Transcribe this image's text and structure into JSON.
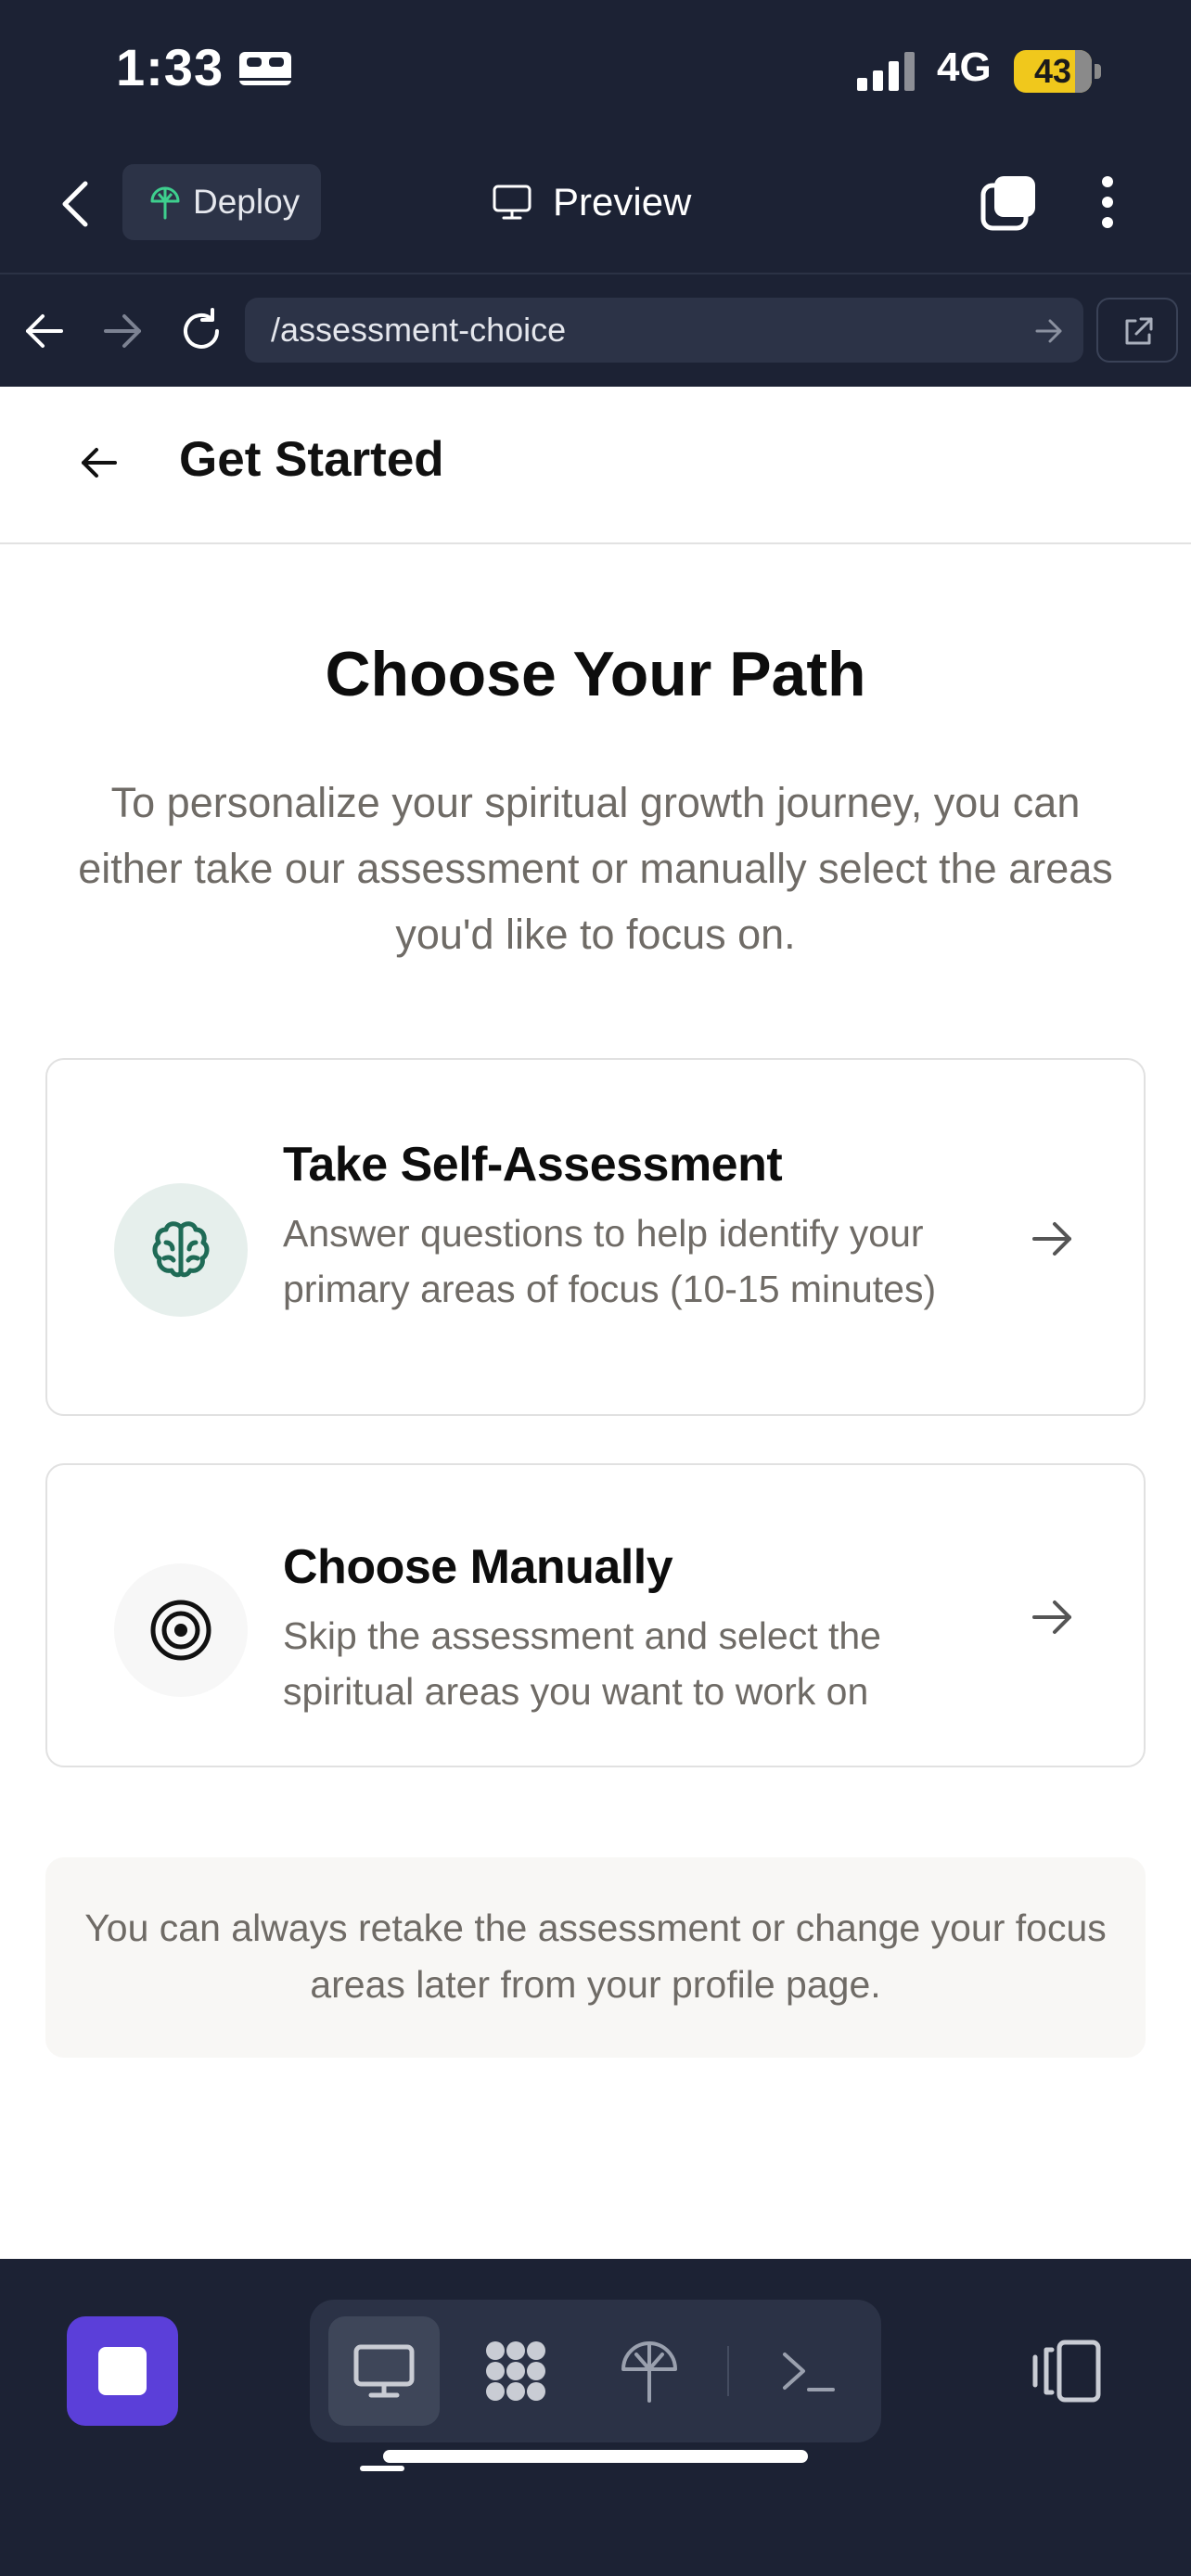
{
  "status_bar": {
    "time": "1:33",
    "network": "4G",
    "battery": "43",
    "icons": [
      "bed-icon",
      "signal-icon",
      "battery-icon"
    ]
  },
  "app_bar": {
    "deploy_label": "Deploy",
    "preview_label": "Preview",
    "icons": [
      "back-chevron-icon",
      "deploy-icon",
      "monitor-icon",
      "tabs-icon",
      "more-vertical-icon"
    ]
  },
  "browser": {
    "url": "/assessment-choice",
    "icons": [
      "arrow-left-icon",
      "arrow-right-icon",
      "reload-icon",
      "go-arrow-icon",
      "open-external-icon"
    ]
  },
  "header": {
    "title": "Get Started"
  },
  "main": {
    "heading": "Choose Your Path",
    "intro": "To personalize your spiritual growth journey, you can either take our assessment or manually select the areas you'd like to focus on.",
    "cards": [
      {
        "title": "Take Self-Assessment",
        "description": "Answer questions to help identify your primary areas of focus (10-15 minutes)",
        "icon": "brain-icon"
      },
      {
        "title": "Choose Manually",
        "description": "Skip the assessment and select the spiritual areas you want to work on",
        "icon": "target-icon"
      }
    ],
    "note": "You can always retake the assessment or change your focus areas later from your profile page."
  },
  "bottom_bar": {
    "icons": [
      "stop-icon",
      "desktop-preview-icon",
      "grid-dots-icon",
      "deploy-icon",
      "terminal-icon",
      "devices-icon"
    ]
  },
  "colors": {
    "chrome": "#1c2234",
    "accent": "#5b3fd9",
    "brain_tint": "#e6efec",
    "brain_stroke": "#1f6b56",
    "muted_text": "#6f6b66"
  }
}
